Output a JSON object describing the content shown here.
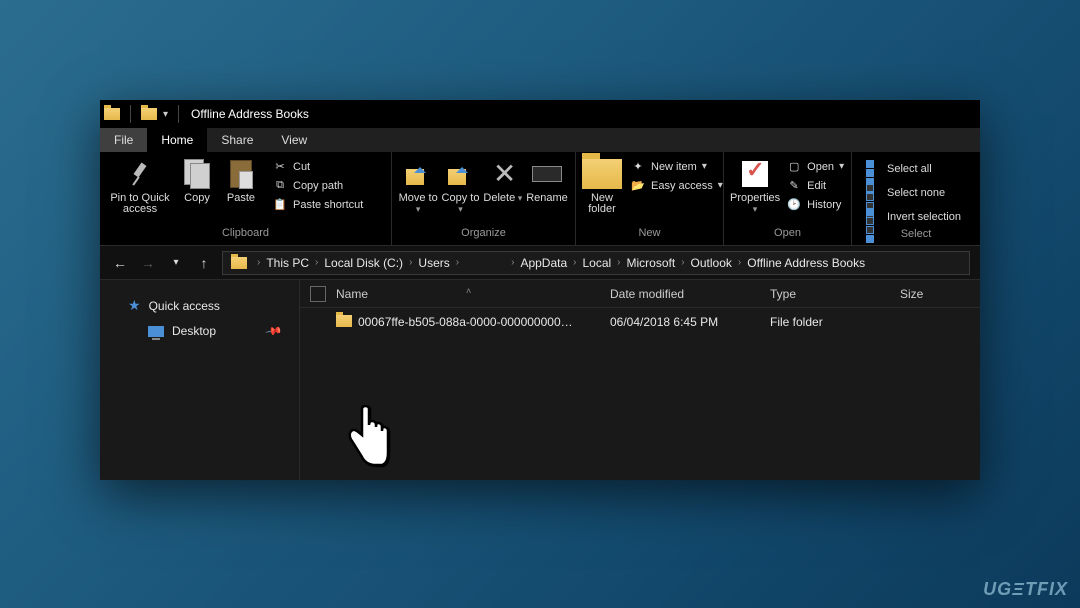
{
  "window": {
    "title": "Offline Address Books"
  },
  "tabs": {
    "file": "File",
    "home": "Home",
    "share": "Share",
    "view": "View"
  },
  "ribbon": {
    "clipboard": {
      "group": "Clipboard",
      "pin": "Pin to Quick access",
      "copy": "Copy",
      "paste": "Paste",
      "cut": "Cut",
      "copy_path": "Copy path",
      "paste_shortcut": "Paste shortcut"
    },
    "organize": {
      "group": "Organize",
      "move_to": "Move to",
      "copy_to": "Copy to",
      "delete": "Delete",
      "rename": "Rename"
    },
    "new": {
      "group": "New",
      "new_folder": "New folder",
      "new_item": "New item",
      "easy_access": "Easy access"
    },
    "open": {
      "group": "Open",
      "properties": "Properties",
      "open": "Open",
      "edit": "Edit",
      "history": "History"
    },
    "select": {
      "group": "Select",
      "select_all": "Select all",
      "select_none": "Select none",
      "invert": "Invert selection"
    }
  },
  "breadcrumbs": [
    "This PC",
    "Local Disk (C:)",
    "Users",
    "",
    "AppData",
    "Local",
    "Microsoft",
    "Outlook",
    "Offline Address Books"
  ],
  "sidebar": {
    "quick_access": "Quick access",
    "desktop": "Desktop"
  },
  "columns": {
    "name": "Name",
    "date": "Date modified",
    "type": "Type",
    "size": "Size"
  },
  "rows": [
    {
      "name": "00067ffe-b505-088a-0000-000000000…",
      "date": "06/04/2018 6:45 PM",
      "type": "File folder",
      "size": ""
    }
  ],
  "watermark": "UGΞTFIX"
}
